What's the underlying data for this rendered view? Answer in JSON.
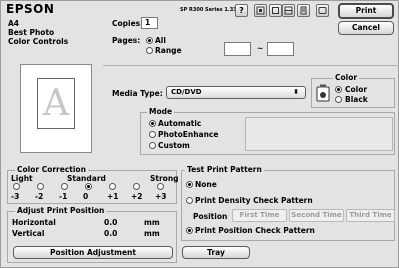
{
  "header": {
    "brand": "EPSON",
    "printer": "SP R300 Series 1.33A",
    "print_label": "Print",
    "cancel_label": "Cancel"
  },
  "summary": {
    "paper": "A4",
    "quality": "Best Photo",
    "color_mode": "Color Controls"
  },
  "copies": {
    "label": "Copies:",
    "value": "1"
  },
  "pages": {
    "label": "Pages:",
    "all": "All",
    "range": "Range",
    "dash": "~",
    "from": "",
    "to": ""
  },
  "media_type": {
    "label": "Media Type:",
    "value": "CD/DVD"
  },
  "color": {
    "title": "Color",
    "color_label": "Color",
    "black_label": "Black"
  },
  "mode": {
    "title": "Mode",
    "options": [
      "Automatic",
      "PhotoEnhance",
      "Custom"
    ],
    "selected": 0
  },
  "color_correction": {
    "title": "Color Correction",
    "light": "Light",
    "standard": "Standard",
    "strong": "Strong",
    "levels": [
      "-3",
      "-2",
      "-1",
      "0",
      "+1",
      "+2",
      "+3"
    ],
    "selected": 3
  },
  "adjust_print_position": {
    "title": "Adjust Print Position",
    "horizontal_label": "Horizontal",
    "horizontal_value": "0.0",
    "horizontal_unit": "mm",
    "vertical_label": "Vertical",
    "vertical_value": "0.0",
    "vertical_unit": "mm",
    "button": "Position Adjustment"
  },
  "test_print_pattern": {
    "title": "Test Print Pattern",
    "none": "None",
    "density": "Print Density Check Pattern",
    "position_label": "Position",
    "first_time": "First Time",
    "second_time": "Second Time",
    "third_time": "Third Time",
    "position_check": "Print Position Check Pattern"
  },
  "tray_label": "Tray",
  "colors": {
    "window_bg": "#e3e3e3",
    "field_bg": "#ffffff"
  },
  "icons": [
    "help-icon",
    "utility-icon",
    "ink-icon",
    "layout-icon",
    "preview-icon",
    "sheet-icon",
    "printer-icon"
  ]
}
